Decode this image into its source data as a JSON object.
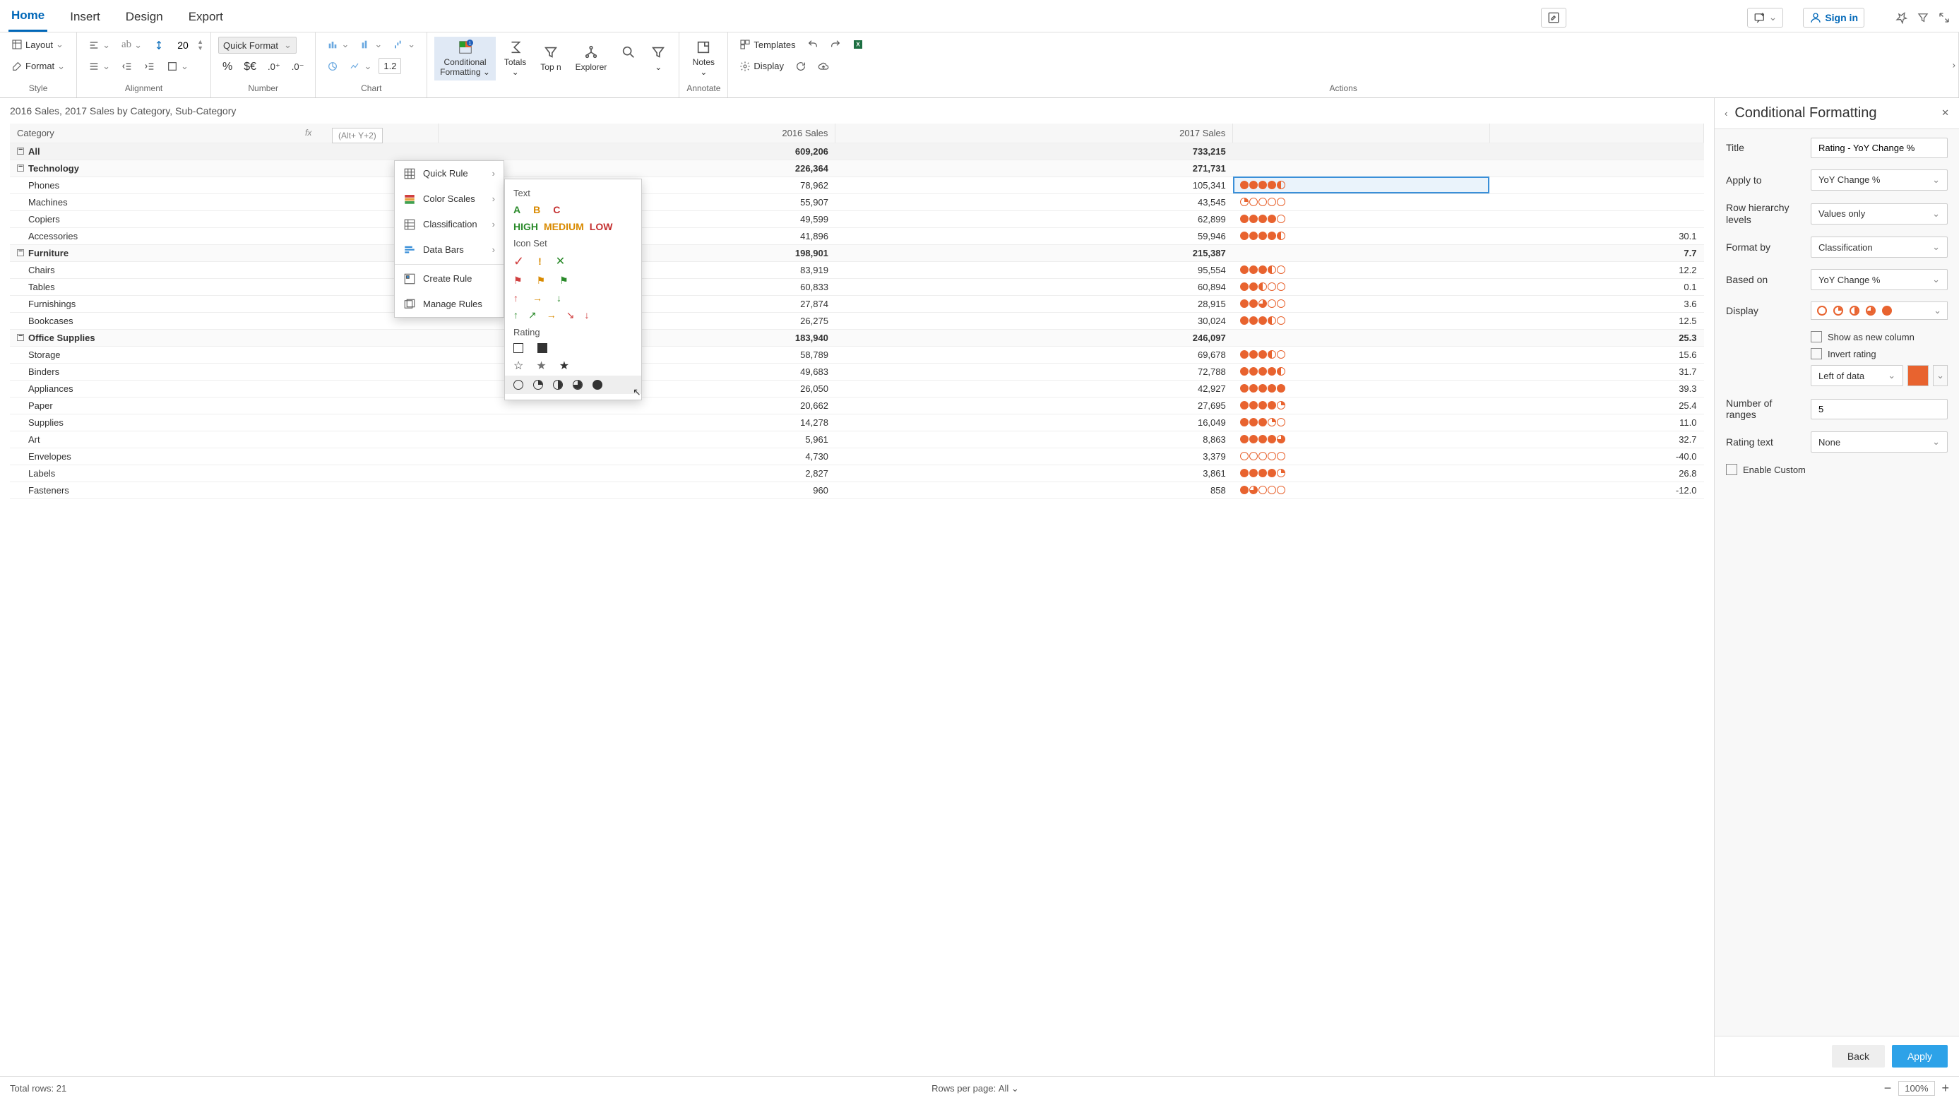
{
  "tabs": {
    "home": "Home",
    "insert": "Insert",
    "design": "Design",
    "export": "Export"
  },
  "signin": "Sign in",
  "ribbon": {
    "style": {
      "layout": "Layout",
      "format": "Format",
      "label": "Style"
    },
    "alignment": {
      "label": "Alignment",
      "fontsize": "20"
    },
    "number": {
      "label": "Number",
      "quick": "Quick Format"
    },
    "chart": {
      "label": "Chart",
      "val": "1.2"
    },
    "cf": {
      "line1": "Conditional",
      "line2": "Formatting"
    },
    "totals": "Totals",
    "topn": "Top n",
    "explorer": "Explorer",
    "notes": "Notes",
    "templates": "Templates",
    "display": "Display",
    "annotate": "Annotate",
    "actions": "Actions"
  },
  "grid_title": "2016 Sales, 2017 Sales by Category, Sub-Category",
  "headers": {
    "category": "Category",
    "s16": "2016 Sales",
    "s17": "2017 Sales",
    "rating": "",
    "pct": ""
  },
  "fx": "fx",
  "shortcut": "(Alt+ Y+2)",
  "rows": {
    "all": {
      "label": "All",
      "s16": "609,206",
      "s17": "733,215"
    },
    "tech": {
      "label": "Technology",
      "s16": "226,364",
      "s17": "271,731"
    },
    "phones": {
      "label": "Phones",
      "s16": "78,962",
      "s17": "105,341"
    },
    "machines": {
      "label": "Machines",
      "s16": "55,907",
      "s17": "43,545"
    },
    "copiers": {
      "label": "Copiers",
      "s16": "49,599",
      "s17": "62,899"
    },
    "accessories": {
      "label": "Accessories",
      "s16": "41,896",
      "s17": "59,946",
      "pct": "30.1"
    },
    "furn": {
      "label": "Furniture",
      "s16": "198,901",
      "s17": "215,387",
      "pct": "7.7"
    },
    "chairs": {
      "label": "Chairs",
      "s16": "83,919",
      "s17": "95,554",
      "pct": "12.2"
    },
    "tables": {
      "label": "Tables",
      "s16": "60,833",
      "s17": "60,894",
      "pct": "0.1"
    },
    "furnishings": {
      "label": "Furnishings",
      "s16": "27,874",
      "s17": "28,915",
      "pct": "3.6"
    },
    "bookcases": {
      "label": "Bookcases",
      "s16": "26,275",
      "s17": "30,024",
      "pct": "12.5"
    },
    "office": {
      "label": "Office Supplies",
      "s16": "183,940",
      "s17": "246,097",
      "pct": "25.3"
    },
    "storage": {
      "label": "Storage",
      "s16": "58,789",
      "s17": "69,678",
      "pct": "15.6"
    },
    "binders": {
      "label": "Binders",
      "s16": "49,683",
      "s17": "72,788",
      "pct": "31.7"
    },
    "appliances": {
      "label": "Appliances",
      "s16": "26,050",
      "s17": "42,927",
      "pct": "39.3"
    },
    "paper": {
      "label": "Paper",
      "s16": "20,662",
      "s17": "27,695",
      "pct": "25.4"
    },
    "supplies": {
      "label": "Supplies",
      "s16": "14,278",
      "s17": "16,049",
      "pct": "11.0"
    },
    "art": {
      "label": "Art",
      "s16": "5,961",
      "s17": "8,863",
      "pct": "32.7"
    },
    "envelopes": {
      "label": "Envelopes",
      "s16": "4,730",
      "s17": "3,379",
      "pct": "-40.0"
    },
    "labels": {
      "label": "Labels",
      "s16": "2,827",
      "s17": "3,861",
      "pct": "26.8"
    },
    "fasteners": {
      "label": "Fasteners",
      "s16": "960",
      "s17": "858",
      "pct": "-12.0"
    }
  },
  "cf_menu": {
    "quick": "Quick Rule",
    "scales": "Color Scales",
    "classification": "Classification",
    "databars": "Data Bars",
    "create": "Create Rule",
    "manage": "Manage Rules"
  },
  "sub": {
    "text": "Text",
    "high": "HIGH",
    "medium": "MEDIUM",
    "low": "LOW",
    "a": "A",
    "b": "B",
    "c": "C",
    "iconset": "Icon Set",
    "rating": "Rating"
  },
  "panel": {
    "title_h": "Conditional Formatting",
    "title_l": "Title",
    "title_v": "Rating - YoY Change %",
    "apply_l": "Apply to",
    "apply_v": "YoY Change %",
    "hier_l": "Row hierarchy levels",
    "hier_v": "Values only",
    "fmt_l": "Format by",
    "fmt_v": "Classification",
    "based_l": "Based on",
    "based_v": "YoY Change %",
    "disp_l": "Display",
    "newcol": "Show as new column",
    "invert": "Invert rating",
    "pos_v": "Left of data",
    "num_l": "Number of ranges",
    "num_v": "5",
    "rtxt_l": "Rating text",
    "rtxt_v": "None",
    "custom": "Enable Custom",
    "back": "Back",
    "apply_btn": "Apply"
  },
  "status": {
    "total": "Total rows: 21",
    "rpp": "Rows per page:",
    "rpp_v": "All",
    "zoom": "100%"
  }
}
